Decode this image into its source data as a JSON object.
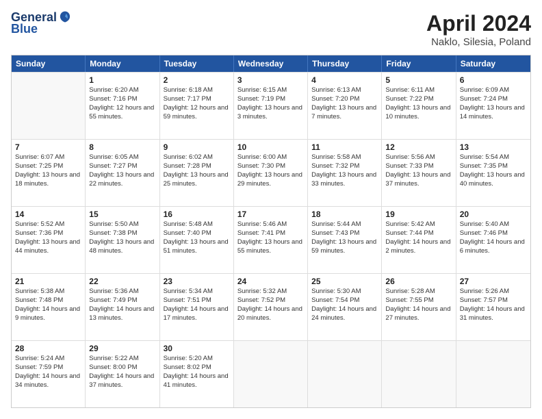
{
  "header": {
    "logo_line1": "General",
    "logo_line2": "Blue",
    "title": "April 2024",
    "subtitle": "Naklo, Silesia, Poland"
  },
  "days_of_week": [
    "Sunday",
    "Monday",
    "Tuesday",
    "Wednesday",
    "Thursday",
    "Friday",
    "Saturday"
  ],
  "weeks": [
    [
      {
        "day": "",
        "sunrise": "",
        "sunset": "",
        "daylight": ""
      },
      {
        "day": "1",
        "sunrise": "Sunrise: 6:20 AM",
        "sunset": "Sunset: 7:16 PM",
        "daylight": "Daylight: 12 hours and 55 minutes."
      },
      {
        "day": "2",
        "sunrise": "Sunrise: 6:18 AM",
        "sunset": "Sunset: 7:17 PM",
        "daylight": "Daylight: 12 hours and 59 minutes."
      },
      {
        "day": "3",
        "sunrise": "Sunrise: 6:15 AM",
        "sunset": "Sunset: 7:19 PM",
        "daylight": "Daylight: 13 hours and 3 minutes."
      },
      {
        "day": "4",
        "sunrise": "Sunrise: 6:13 AM",
        "sunset": "Sunset: 7:20 PM",
        "daylight": "Daylight: 13 hours and 7 minutes."
      },
      {
        "day": "5",
        "sunrise": "Sunrise: 6:11 AM",
        "sunset": "Sunset: 7:22 PM",
        "daylight": "Daylight: 13 hours and 10 minutes."
      },
      {
        "day": "6",
        "sunrise": "Sunrise: 6:09 AM",
        "sunset": "Sunset: 7:24 PM",
        "daylight": "Daylight: 13 hours and 14 minutes."
      }
    ],
    [
      {
        "day": "7",
        "sunrise": "Sunrise: 6:07 AM",
        "sunset": "Sunset: 7:25 PM",
        "daylight": "Daylight: 13 hours and 18 minutes."
      },
      {
        "day": "8",
        "sunrise": "Sunrise: 6:05 AM",
        "sunset": "Sunset: 7:27 PM",
        "daylight": "Daylight: 13 hours and 22 minutes."
      },
      {
        "day": "9",
        "sunrise": "Sunrise: 6:02 AM",
        "sunset": "Sunset: 7:28 PM",
        "daylight": "Daylight: 13 hours and 25 minutes."
      },
      {
        "day": "10",
        "sunrise": "Sunrise: 6:00 AM",
        "sunset": "Sunset: 7:30 PM",
        "daylight": "Daylight: 13 hours and 29 minutes."
      },
      {
        "day": "11",
        "sunrise": "Sunrise: 5:58 AM",
        "sunset": "Sunset: 7:32 PM",
        "daylight": "Daylight: 13 hours and 33 minutes."
      },
      {
        "day": "12",
        "sunrise": "Sunrise: 5:56 AM",
        "sunset": "Sunset: 7:33 PM",
        "daylight": "Daylight: 13 hours and 37 minutes."
      },
      {
        "day": "13",
        "sunrise": "Sunrise: 5:54 AM",
        "sunset": "Sunset: 7:35 PM",
        "daylight": "Daylight: 13 hours and 40 minutes."
      }
    ],
    [
      {
        "day": "14",
        "sunrise": "Sunrise: 5:52 AM",
        "sunset": "Sunset: 7:36 PM",
        "daylight": "Daylight: 13 hours and 44 minutes."
      },
      {
        "day": "15",
        "sunrise": "Sunrise: 5:50 AM",
        "sunset": "Sunset: 7:38 PM",
        "daylight": "Daylight: 13 hours and 48 minutes."
      },
      {
        "day": "16",
        "sunrise": "Sunrise: 5:48 AM",
        "sunset": "Sunset: 7:40 PM",
        "daylight": "Daylight: 13 hours and 51 minutes."
      },
      {
        "day": "17",
        "sunrise": "Sunrise: 5:46 AM",
        "sunset": "Sunset: 7:41 PM",
        "daylight": "Daylight: 13 hours and 55 minutes."
      },
      {
        "day": "18",
        "sunrise": "Sunrise: 5:44 AM",
        "sunset": "Sunset: 7:43 PM",
        "daylight": "Daylight: 13 hours and 59 minutes."
      },
      {
        "day": "19",
        "sunrise": "Sunrise: 5:42 AM",
        "sunset": "Sunset: 7:44 PM",
        "daylight": "Daylight: 14 hours and 2 minutes."
      },
      {
        "day": "20",
        "sunrise": "Sunrise: 5:40 AM",
        "sunset": "Sunset: 7:46 PM",
        "daylight": "Daylight: 14 hours and 6 minutes."
      }
    ],
    [
      {
        "day": "21",
        "sunrise": "Sunrise: 5:38 AM",
        "sunset": "Sunset: 7:48 PM",
        "daylight": "Daylight: 14 hours and 9 minutes."
      },
      {
        "day": "22",
        "sunrise": "Sunrise: 5:36 AM",
        "sunset": "Sunset: 7:49 PM",
        "daylight": "Daylight: 14 hours and 13 minutes."
      },
      {
        "day": "23",
        "sunrise": "Sunrise: 5:34 AM",
        "sunset": "Sunset: 7:51 PM",
        "daylight": "Daylight: 14 hours and 17 minutes."
      },
      {
        "day": "24",
        "sunrise": "Sunrise: 5:32 AM",
        "sunset": "Sunset: 7:52 PM",
        "daylight": "Daylight: 14 hours and 20 minutes."
      },
      {
        "day": "25",
        "sunrise": "Sunrise: 5:30 AM",
        "sunset": "Sunset: 7:54 PM",
        "daylight": "Daylight: 14 hours and 24 minutes."
      },
      {
        "day": "26",
        "sunrise": "Sunrise: 5:28 AM",
        "sunset": "Sunset: 7:55 PM",
        "daylight": "Daylight: 14 hours and 27 minutes."
      },
      {
        "day": "27",
        "sunrise": "Sunrise: 5:26 AM",
        "sunset": "Sunset: 7:57 PM",
        "daylight": "Daylight: 14 hours and 31 minutes."
      }
    ],
    [
      {
        "day": "28",
        "sunrise": "Sunrise: 5:24 AM",
        "sunset": "Sunset: 7:59 PM",
        "daylight": "Daylight: 14 hours and 34 minutes."
      },
      {
        "day": "29",
        "sunrise": "Sunrise: 5:22 AM",
        "sunset": "Sunset: 8:00 PM",
        "daylight": "Daylight: 14 hours and 37 minutes."
      },
      {
        "day": "30",
        "sunrise": "Sunrise: 5:20 AM",
        "sunset": "Sunset: 8:02 PM",
        "daylight": "Daylight: 14 hours and 41 minutes."
      },
      {
        "day": "",
        "sunrise": "",
        "sunset": "",
        "daylight": ""
      },
      {
        "day": "",
        "sunrise": "",
        "sunset": "",
        "daylight": ""
      },
      {
        "day": "",
        "sunrise": "",
        "sunset": "",
        "daylight": ""
      },
      {
        "day": "",
        "sunrise": "",
        "sunset": "",
        "daylight": ""
      }
    ]
  ]
}
